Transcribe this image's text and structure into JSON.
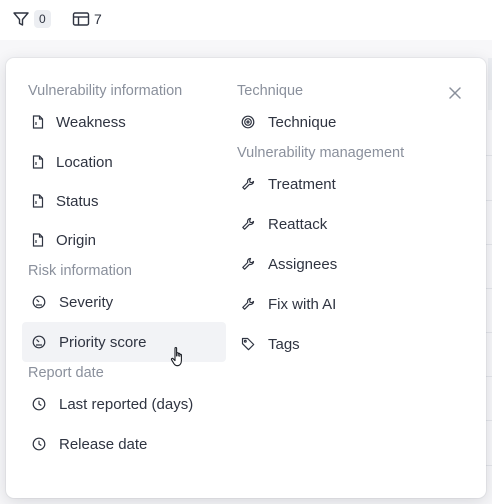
{
  "toolbar": {
    "filter_count": "0",
    "columns_count": "7",
    "filter_icon": "filter-icon",
    "columns_icon": "table-columns-icon"
  },
  "panel": {
    "close_icon": "close-icon",
    "left_sections": {
      "vulnerability_information": {
        "title": "Vulnerability information",
        "items": [
          "Weakness",
          "Location",
          "Status",
          "Origin"
        ]
      },
      "risk_information": {
        "title": "Risk information",
        "items": [
          "Severity",
          "Priority score"
        ]
      },
      "report_date": {
        "title": "Report date",
        "items": [
          "Last reported (days)",
          "Release date"
        ]
      }
    },
    "right_sections": {
      "technique": {
        "title": "Technique",
        "items": [
          "Technique"
        ]
      },
      "vulnerability_management": {
        "title": "Vulnerability management",
        "items": [
          "Treatment",
          "Reattack",
          "Assignees",
          "Fix with AI",
          "Tags"
        ]
      }
    },
    "hovered_item": "Priority score"
  },
  "colors": {
    "section_heading": "#8a909c",
    "item_text": "#2f3441",
    "hover_bg": "#f2f3f6",
    "panel_bg": "#ffffff"
  }
}
